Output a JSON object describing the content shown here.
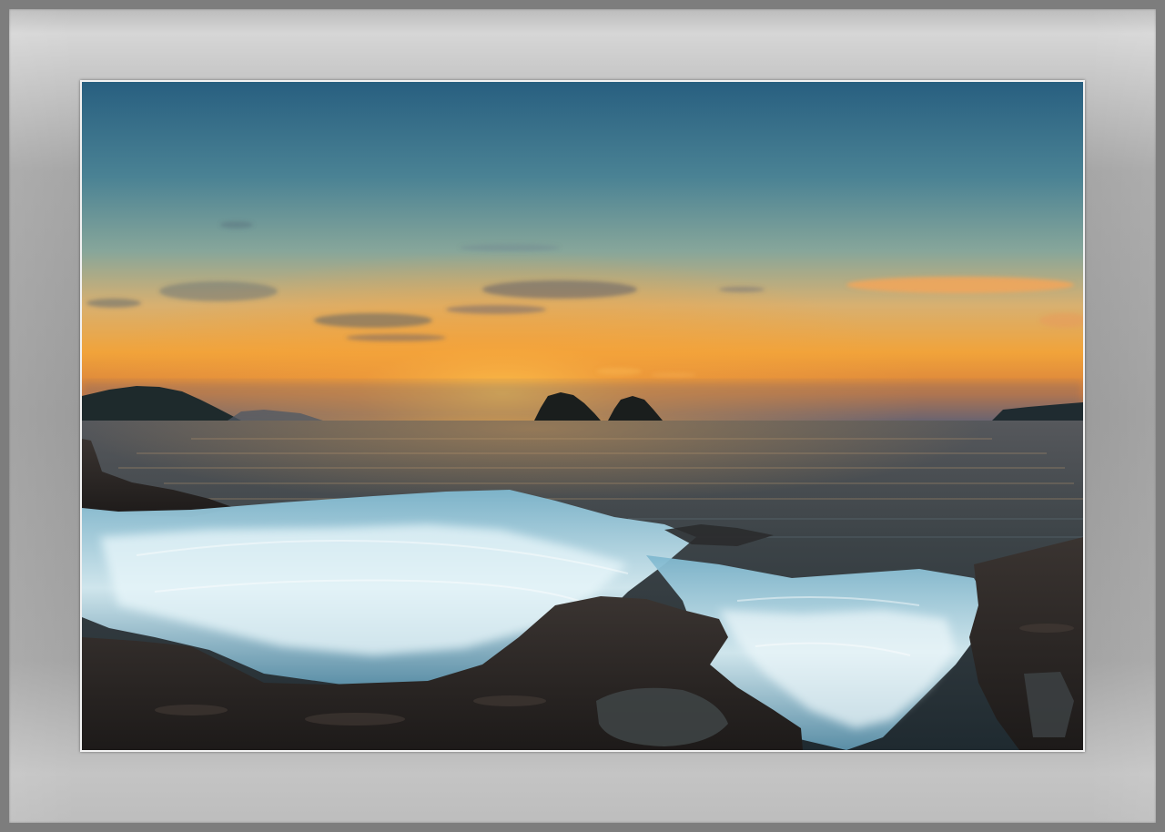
{
  "frame": {
    "outer_color": "#7d7d7d",
    "mat_color": "#a6a6a6",
    "border_color": "#f2f2f2"
  },
  "photo": {
    "subject": "sunset-over-sea-with-waves-on-rocks",
    "colors": {
      "sky_top": "#2a6584",
      "sky_mid": "#6d9aa0",
      "sky_horizon": "#f3a63c",
      "sun_glow": "#ffb43a",
      "sea": "#3b3f3f",
      "foam": "#dff2f7",
      "rock": "#2a2523"
    }
  }
}
